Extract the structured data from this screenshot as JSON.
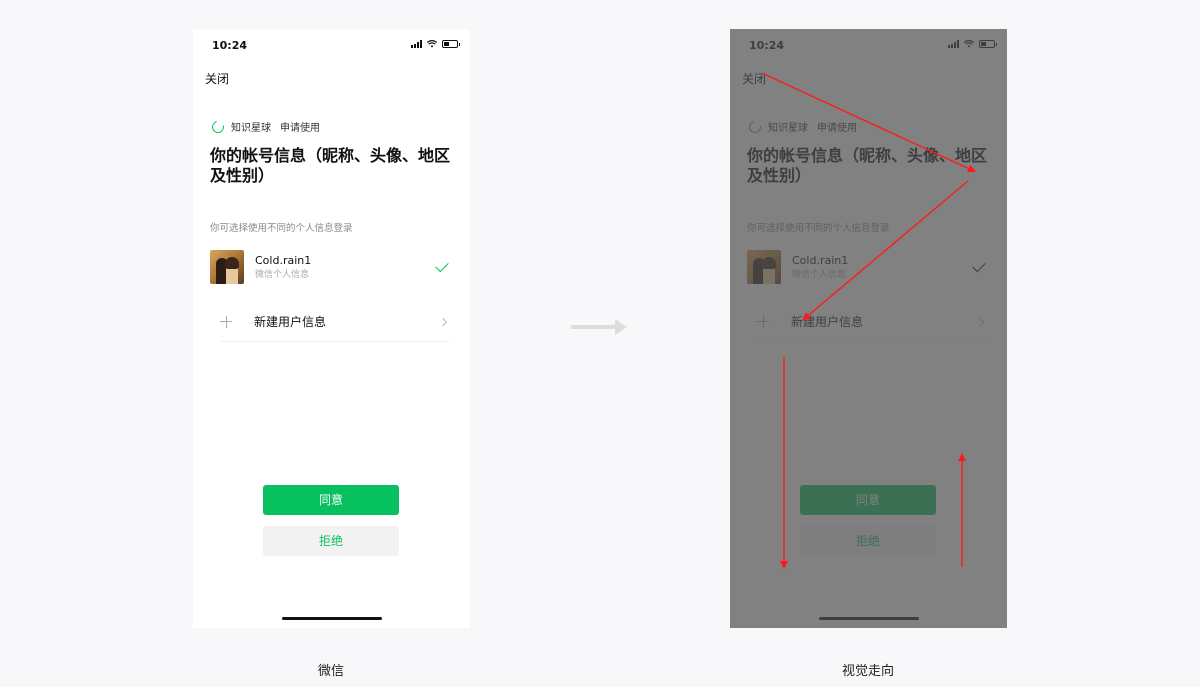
{
  "phones": [
    {
      "status_time": "10:24",
      "close_label": "关闭",
      "app_name": "知识星球",
      "app_action": "申请使用",
      "title": "你的帐号信息（昵称、头像、地区及性别）",
      "hint": "你可选择使用不同的个人信息登录",
      "account_name": "Cold.rain1",
      "account_sub": "微信个人信息",
      "new_user_label": "新建用户信息",
      "agree_label": "同意",
      "reject_label": "拒绝"
    },
    {
      "status_time": "10:24",
      "close_label": "关闭",
      "app_name": "知识星球",
      "app_action": "申请使用",
      "title": "你的帐号信息（昵称、头像、地区及性别）",
      "hint": "你可选择使用不同的个人信息登录",
      "account_name": "Cold.rain1",
      "account_sub": "微信个人信息",
      "new_user_label": "新建用户信息",
      "agree_label": "同意",
      "reject_label": "拒绝"
    }
  ],
  "captions": {
    "left": "微信",
    "right": "视觉走向"
  },
  "colors": {
    "accent": "#07c160",
    "overlay": "#505050",
    "arrow": "#ff1a1a",
    "flow_arrow": "#dddddd"
  }
}
